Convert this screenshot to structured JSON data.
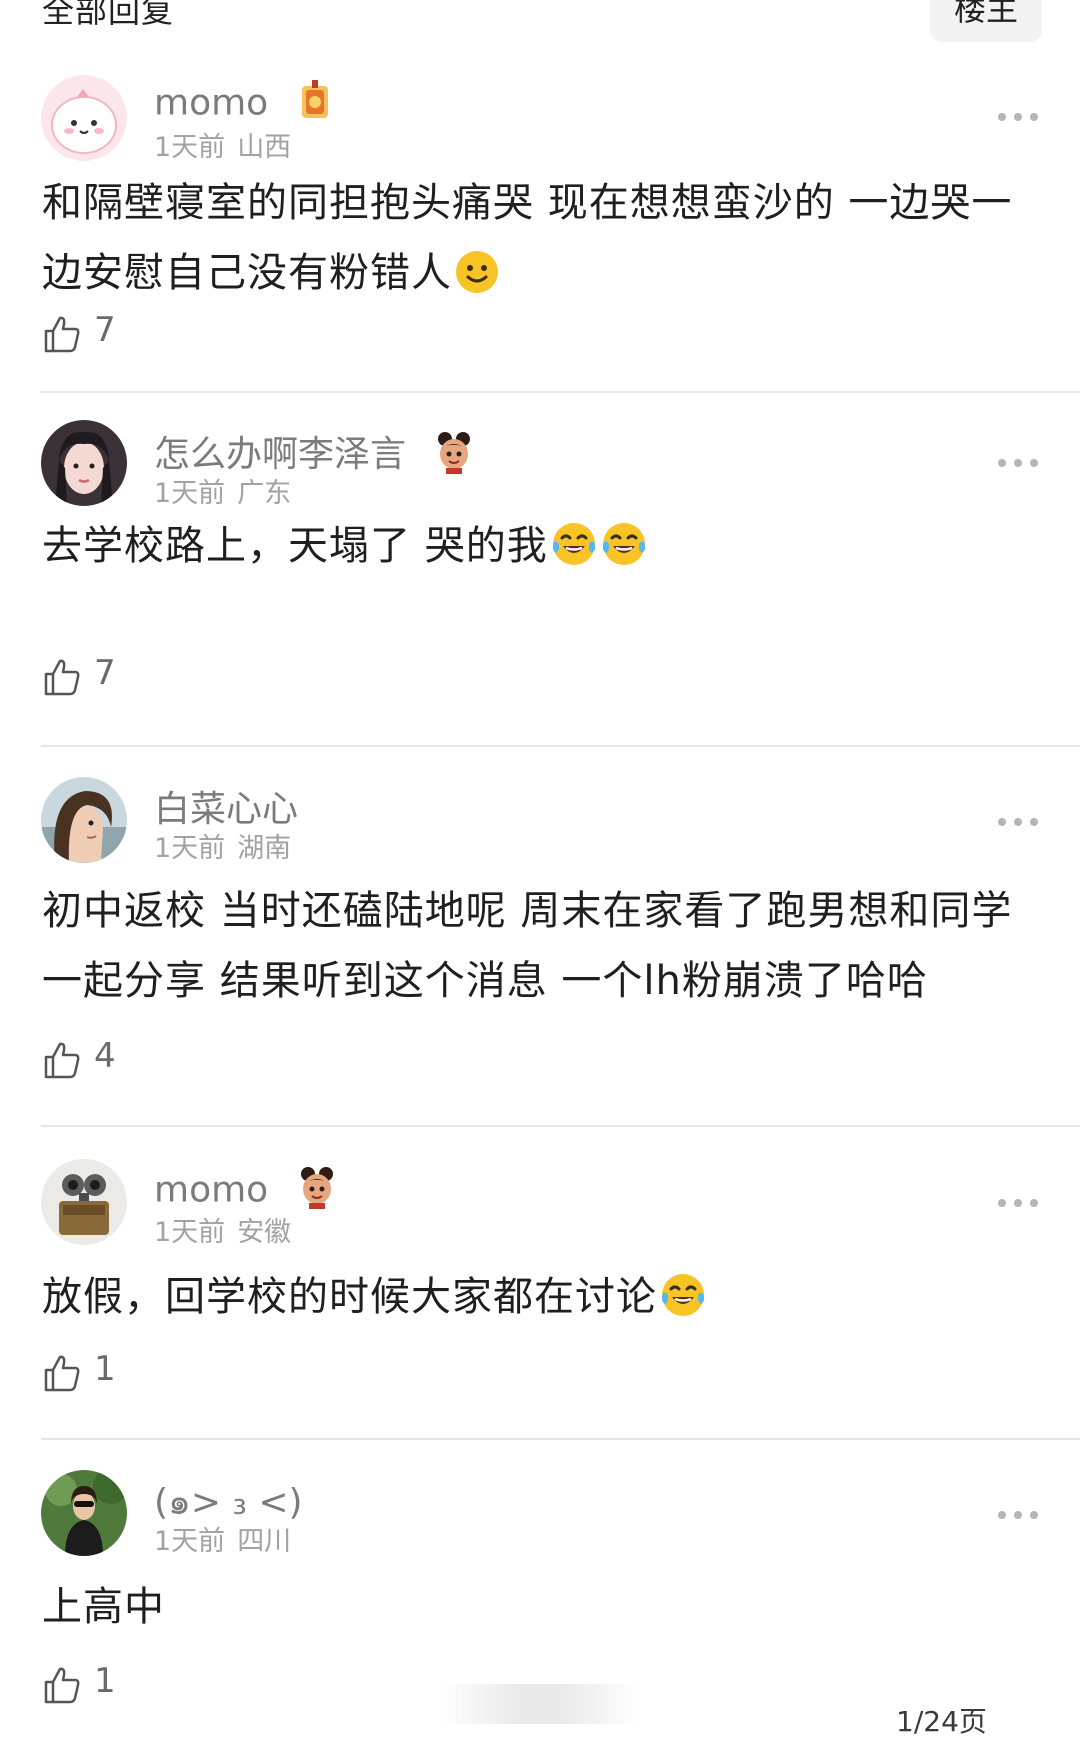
{
  "header": {
    "title": "全部回复",
    "op_label": "楼主"
  },
  "comments": [
    {
      "username": "momo",
      "badge": "lucky-charm-badge",
      "time": "1天前",
      "location": "山西",
      "text": "和隔壁寝室的同担抱头痛哭 现在想想蛮沙的 一边哭一边安慰自己没有粉错人",
      "emojis": [
        "smile-emoji"
      ],
      "likes": "7"
    },
    {
      "username": "怎么办啊李泽言",
      "badge": "nezha-badge",
      "time": "1天前",
      "location": "广东",
      "text": "去学校路上，天塌了 哭的我",
      "emojis": [
        "tears-of-joy-emoji",
        "tears-of-joy-emoji"
      ],
      "likes": "7"
    },
    {
      "username": "白菜心心",
      "badge": "",
      "time": "1天前",
      "location": "湖南",
      "text": "初中返校 当时还磕陆地呢 周末在家看了跑男想和同学一起分享 结果听到这个消息 一个lh粉崩溃了哈哈",
      "emojis": [],
      "likes": "4"
    },
    {
      "username": "momo",
      "badge": "nezha-badge",
      "time": "1天前",
      "location": "安徽",
      "text": "放假，回学校的时候大家都在讨论",
      "emojis": [
        "tears-of-joy-emoji"
      ],
      "likes": "1"
    },
    {
      "username": "(๑> ₃ <)",
      "badge": "",
      "time": "1天前",
      "location": "四川",
      "text": "上高中",
      "emojis": [],
      "likes": "1"
    }
  ],
  "footer": {
    "page_indicator": "1/24页"
  },
  "colors": {
    "username": "#7b7b7b",
    "meta": "#a2a2a2",
    "divider": "#e6e6e6",
    "emoji": "#f7c325"
  }
}
